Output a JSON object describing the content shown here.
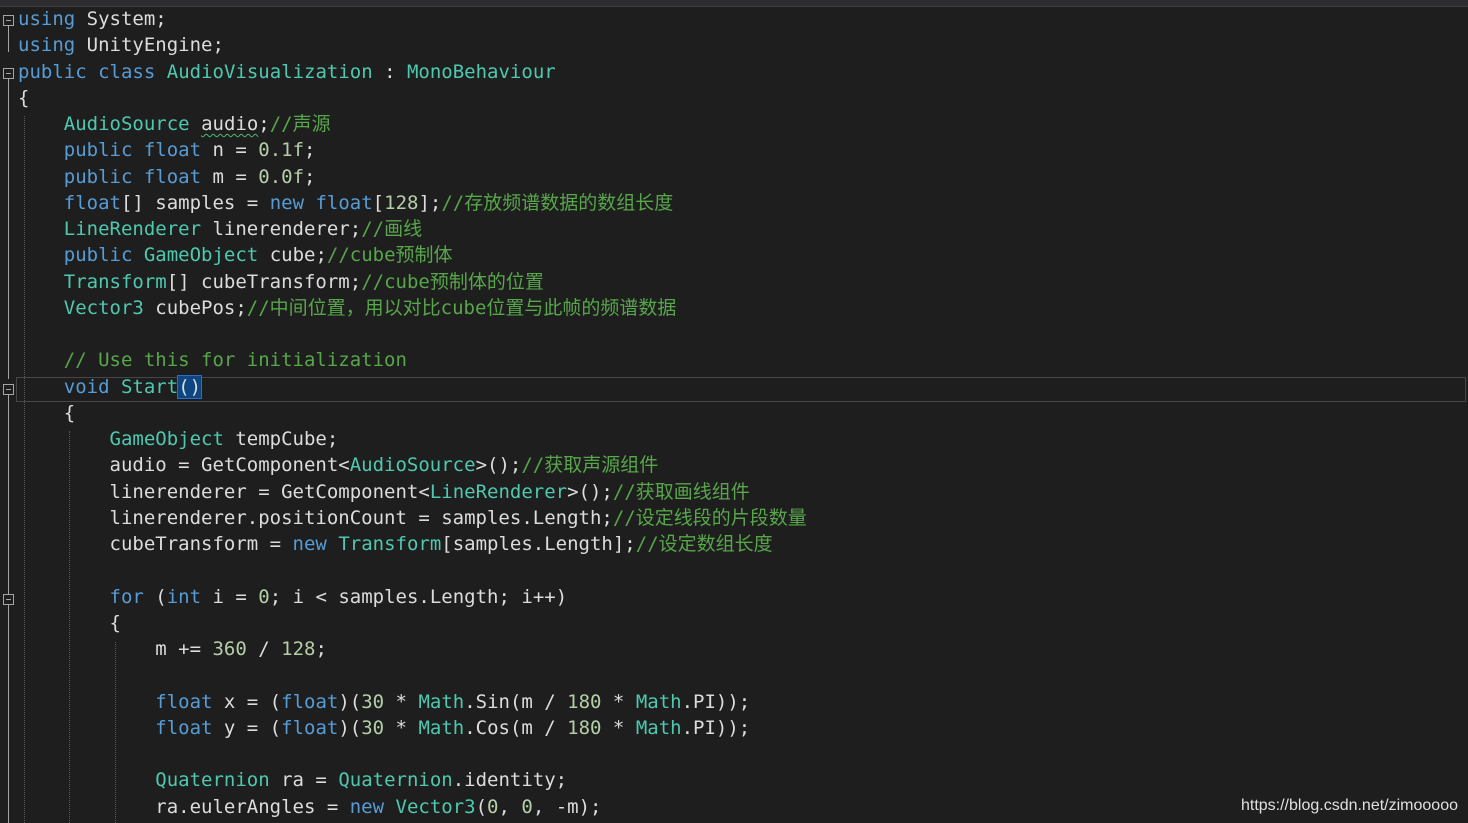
{
  "editor": {
    "lines": [
      [
        {
          "t": "using",
          "c": "kw"
        },
        {
          "t": " System;",
          "c": "def"
        }
      ],
      [
        {
          "t": "using",
          "c": "kw"
        },
        {
          "t": " UnityEngine;",
          "c": "def"
        }
      ],
      [
        {
          "t": "public",
          "c": "kw"
        },
        {
          "t": " ",
          "c": "def"
        },
        {
          "t": "class",
          "c": "kw"
        },
        {
          "t": " ",
          "c": "def"
        },
        {
          "t": "AudioVisualization",
          "c": "type"
        },
        {
          "t": " : ",
          "c": "def"
        },
        {
          "t": "MonoBehaviour",
          "c": "type"
        }
      ],
      [
        {
          "t": "{",
          "c": "def"
        }
      ],
      [
        {
          "t": "    ",
          "c": "def"
        },
        {
          "t": "AudioSource",
          "c": "type"
        },
        {
          "t": " ",
          "c": "def"
        },
        {
          "t": "audio",
          "c": "def",
          "sq": true
        },
        {
          "t": ";",
          "c": "def"
        },
        {
          "t": "//声源",
          "c": "cm"
        }
      ],
      [
        {
          "t": "    ",
          "c": "def"
        },
        {
          "t": "public",
          "c": "kw"
        },
        {
          "t": " ",
          "c": "def"
        },
        {
          "t": "float",
          "c": "kw"
        },
        {
          "t": " n = ",
          "c": "def"
        },
        {
          "t": "0.1f",
          "c": "num"
        },
        {
          "t": ";",
          "c": "def"
        }
      ],
      [
        {
          "t": "    ",
          "c": "def"
        },
        {
          "t": "public",
          "c": "kw"
        },
        {
          "t": " ",
          "c": "def"
        },
        {
          "t": "float",
          "c": "kw"
        },
        {
          "t": " m = ",
          "c": "def"
        },
        {
          "t": "0.0f",
          "c": "num"
        },
        {
          "t": ";",
          "c": "def"
        }
      ],
      [
        {
          "t": "    ",
          "c": "def"
        },
        {
          "t": "float",
          "c": "kw"
        },
        {
          "t": "[] samples = ",
          "c": "def"
        },
        {
          "t": "new",
          "c": "kw"
        },
        {
          "t": " ",
          "c": "def"
        },
        {
          "t": "float",
          "c": "kw"
        },
        {
          "t": "[",
          "c": "def"
        },
        {
          "t": "128",
          "c": "num"
        },
        {
          "t": "];",
          "c": "def"
        },
        {
          "t": "//存放频谱数据的数组长度",
          "c": "cm"
        }
      ],
      [
        {
          "t": "    ",
          "c": "def"
        },
        {
          "t": "LineRenderer",
          "c": "type"
        },
        {
          "t": " linerenderer;",
          "c": "def"
        },
        {
          "t": "//画线",
          "c": "cm"
        }
      ],
      [
        {
          "t": "    ",
          "c": "def"
        },
        {
          "t": "public",
          "c": "kw"
        },
        {
          "t": " ",
          "c": "def"
        },
        {
          "t": "GameObject",
          "c": "type"
        },
        {
          "t": " cube;",
          "c": "def"
        },
        {
          "t": "//cube预制体",
          "c": "cm"
        }
      ],
      [
        {
          "t": "    ",
          "c": "def"
        },
        {
          "t": "Transform",
          "c": "type"
        },
        {
          "t": "[] cubeTransform;",
          "c": "def"
        },
        {
          "t": "//cube预制体的位置",
          "c": "cm"
        }
      ],
      [
        {
          "t": "    ",
          "c": "def"
        },
        {
          "t": "Vector3",
          "c": "type"
        },
        {
          "t": " cubePos;",
          "c": "def"
        },
        {
          "t": "//中间位置，用以对比cube位置与此帧的频谱数据",
          "c": "cm"
        }
      ],
      [],
      [
        {
          "t": "    ",
          "c": "def"
        },
        {
          "t": "// Use this for initialization",
          "c": "cm"
        }
      ],
      [
        {
          "t": "    ",
          "c": "def"
        },
        {
          "t": "void",
          "c": "kw"
        },
        {
          "t": " ",
          "c": "def"
        },
        {
          "t": "Start",
          "c": "type"
        },
        {
          "t": "()",
          "c": "def",
          "hl": true
        }
      ],
      [
        {
          "t": "    {",
          "c": "def"
        }
      ],
      [
        {
          "t": "        ",
          "c": "def"
        },
        {
          "t": "GameObject",
          "c": "type"
        },
        {
          "t": " tempCube;",
          "c": "def"
        }
      ],
      [
        {
          "t": "        audio = GetComponent<",
          "c": "def"
        },
        {
          "t": "AudioSource",
          "c": "type"
        },
        {
          "t": ">();",
          "c": "def"
        },
        {
          "t": "//获取声源组件",
          "c": "cm"
        }
      ],
      [
        {
          "t": "        linerenderer = GetComponent<",
          "c": "def"
        },
        {
          "t": "LineRenderer",
          "c": "type"
        },
        {
          "t": ">();",
          "c": "def"
        },
        {
          "t": "//获取画线组件",
          "c": "cm"
        }
      ],
      [
        {
          "t": "        linerenderer.positionCount = samples.Length;",
          "c": "def"
        },
        {
          "t": "//设定线段的片段数量",
          "c": "cm"
        }
      ],
      [
        {
          "t": "        cubeTransform = ",
          "c": "def"
        },
        {
          "t": "new",
          "c": "kw"
        },
        {
          "t": " ",
          "c": "def"
        },
        {
          "t": "Transform",
          "c": "type"
        },
        {
          "t": "[samples.Length];",
          "c": "def"
        },
        {
          "t": "//设定数组长度",
          "c": "cm"
        }
      ],
      [],
      [
        {
          "t": "        ",
          "c": "def"
        },
        {
          "t": "for",
          "c": "kw"
        },
        {
          "t": " (",
          "c": "def"
        },
        {
          "t": "int",
          "c": "kw"
        },
        {
          "t": " i = ",
          "c": "def"
        },
        {
          "t": "0",
          "c": "num"
        },
        {
          "t": "; i < samples.Length; i++)",
          "c": "def"
        }
      ],
      [
        {
          "t": "        {",
          "c": "def"
        }
      ],
      [
        {
          "t": "            m += ",
          "c": "def"
        },
        {
          "t": "360",
          "c": "num"
        },
        {
          "t": " / ",
          "c": "def"
        },
        {
          "t": "128",
          "c": "num"
        },
        {
          "t": ";",
          "c": "def"
        }
      ],
      [],
      [
        {
          "t": "            ",
          "c": "def"
        },
        {
          "t": "float",
          "c": "kw"
        },
        {
          "t": " x = (",
          "c": "def"
        },
        {
          "t": "float",
          "c": "kw"
        },
        {
          "t": ")(",
          "c": "def"
        },
        {
          "t": "30",
          "c": "num"
        },
        {
          "t": " * ",
          "c": "def"
        },
        {
          "t": "Math",
          "c": "type"
        },
        {
          "t": ".Sin(m / ",
          "c": "def"
        },
        {
          "t": "180",
          "c": "num"
        },
        {
          "t": " * ",
          "c": "def"
        },
        {
          "t": "Math",
          "c": "type"
        },
        {
          "t": ".PI));",
          "c": "def"
        }
      ],
      [
        {
          "t": "            ",
          "c": "def"
        },
        {
          "t": "float",
          "c": "kw"
        },
        {
          "t": " y = (",
          "c": "def"
        },
        {
          "t": "float",
          "c": "kw"
        },
        {
          "t": ")(",
          "c": "def"
        },
        {
          "t": "30",
          "c": "num"
        },
        {
          "t": " * ",
          "c": "def"
        },
        {
          "t": "Math",
          "c": "type"
        },
        {
          "t": ".Cos(m / ",
          "c": "def"
        },
        {
          "t": "180",
          "c": "num"
        },
        {
          "t": " * ",
          "c": "def"
        },
        {
          "t": "Math",
          "c": "type"
        },
        {
          "t": ".PI));",
          "c": "def"
        }
      ],
      [],
      [
        {
          "t": "            ",
          "c": "def"
        },
        {
          "t": "Quaternion",
          "c": "type"
        },
        {
          "t": " ra = ",
          "c": "def"
        },
        {
          "t": "Quaternion",
          "c": "type"
        },
        {
          "t": ".identity;",
          "c": "def"
        }
      ],
      [
        {
          "t": "            ra.eulerAngles = ",
          "c": "def"
        },
        {
          "t": "new",
          "c": "kw"
        },
        {
          "t": " ",
          "c": "def"
        },
        {
          "t": "Vector3",
          "c": "type"
        },
        {
          "t": "(",
          "c": "def"
        },
        {
          "t": "0",
          "c": "num"
        },
        {
          "t": ", ",
          "c": "def"
        },
        {
          "t": "0",
          "c": "num"
        },
        {
          "t": ", -m);",
          "c": "def"
        }
      ]
    ]
  },
  "watermark": "https://blog.csdn.net/zimooooo"
}
